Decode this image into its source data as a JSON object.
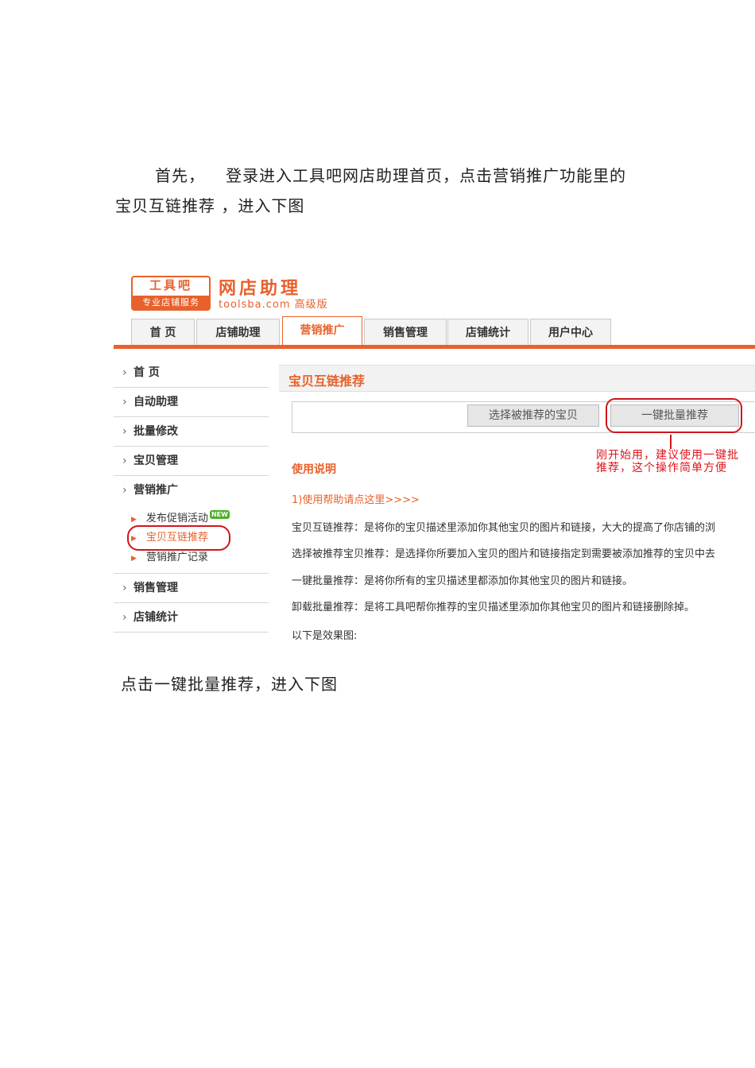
{
  "doc": {
    "para1_lead": "首先，",
    "para1_rest": "登录进入工具吧网店助理首页，点击营销推广功能里的宝贝互链推荐 ，进入下图",
    "para2": "点击一键批量推荐，进入下图"
  },
  "screenshot": {
    "logo_top": "工具吧",
    "logo_bottom": "专业店铺服务",
    "brand_title": "网店助理",
    "brand_sub": "toolsba.com 高级版",
    "tabs": [
      "首  页",
      "店铺助理",
      "营销推广",
      "销售管理",
      "店铺统计",
      "用户中心"
    ],
    "active_tab": "营销推广",
    "sidebar": {
      "items": [
        "首  页",
        "自动助理",
        "批量修改",
        "宝贝管理",
        "营销推广",
        "销售管理",
        "店铺统计"
      ],
      "sub_items": [
        "发布促销活动",
        "宝贝互链推荐",
        "营销推广记录"
      ],
      "new_badge": "NEW",
      "active_sub": "宝贝互链推荐"
    },
    "panel_title": "宝贝互链推荐",
    "btn_select": "选择被推荐的宝贝",
    "btn_batch": "一键批量推荐",
    "tip_line1": "刚开始用，建议使用一键批",
    "tip_line2": "推荐，这个操作简单方便",
    "usage_title": "使用说明",
    "help_link": "1)使用帮助请点这里>>>>",
    "descriptions": [
      "宝贝互链推荐：是将你的宝贝描述里添加你其他宝贝的图片和链接，大大的提高了你店铺的浏",
      "选择被推荐宝贝推荐：是选择你所要加入宝贝的图片和链接指定到需要被添加推荐的宝贝中去",
      "一键批量推荐：是将你所有的宝贝描述里都添加你其他宝贝的图片和链接。",
      "卸载批量推荐：是将工具吧帮你推荐的宝贝描述里添加你其他宝贝的图片和链接删除掉。",
      "以下是效果图:"
    ],
    "accent_color": "#e8612c",
    "highlight_color": "#d0151b"
  }
}
